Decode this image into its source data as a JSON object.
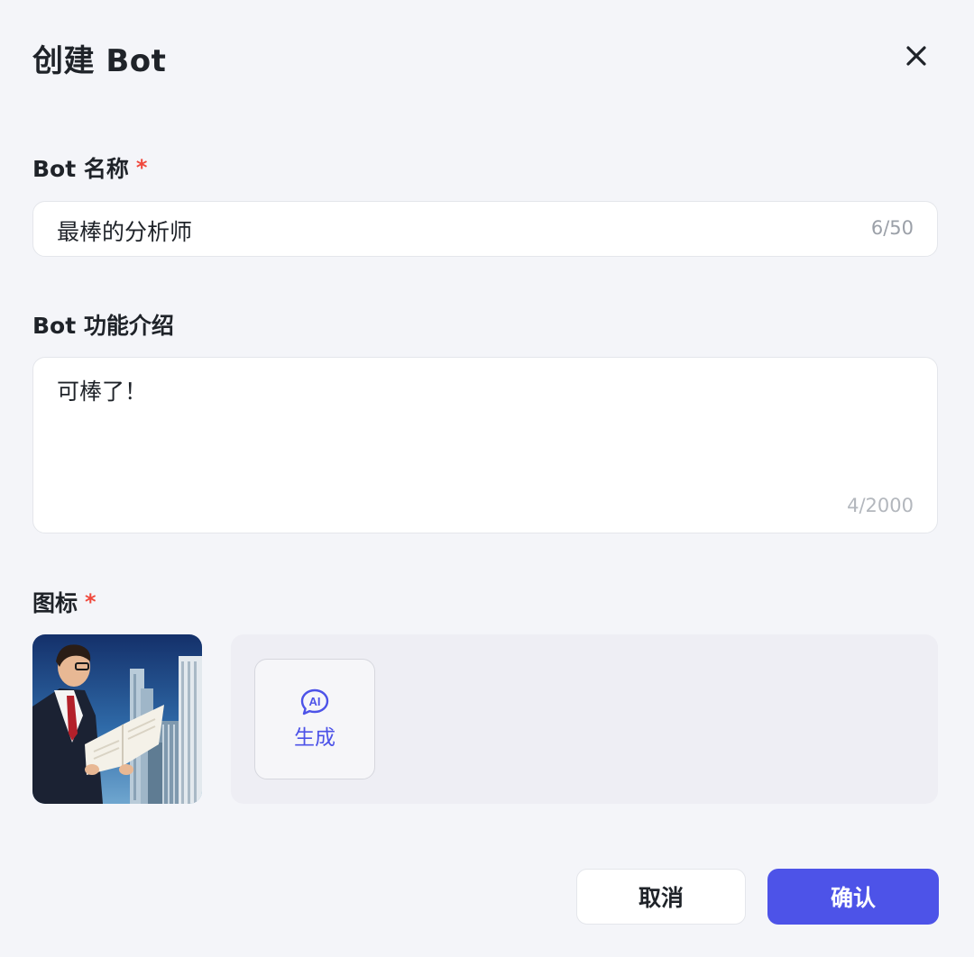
{
  "dialog": {
    "title": "创建 Bot",
    "close_icon": "close-icon"
  },
  "name_field": {
    "label": "Bot 名称",
    "required_mark": "*",
    "value": "最棒的分析师",
    "counter": "6/50"
  },
  "description_field": {
    "label": "Bot 功能介绍",
    "value": "可棒了！",
    "counter": "4/2000"
  },
  "icon_field": {
    "label": "图标",
    "required_mark": "*",
    "image_icon": "businessman-reading-document-image",
    "generate_icon": "ai-chat-bubble-icon",
    "generate_label": "生成"
  },
  "footer": {
    "cancel_label": "取消",
    "confirm_label": "确认"
  },
  "colors": {
    "accent": "#4d53e8",
    "required": "#f0483c",
    "background": "#f4f5f9"
  }
}
